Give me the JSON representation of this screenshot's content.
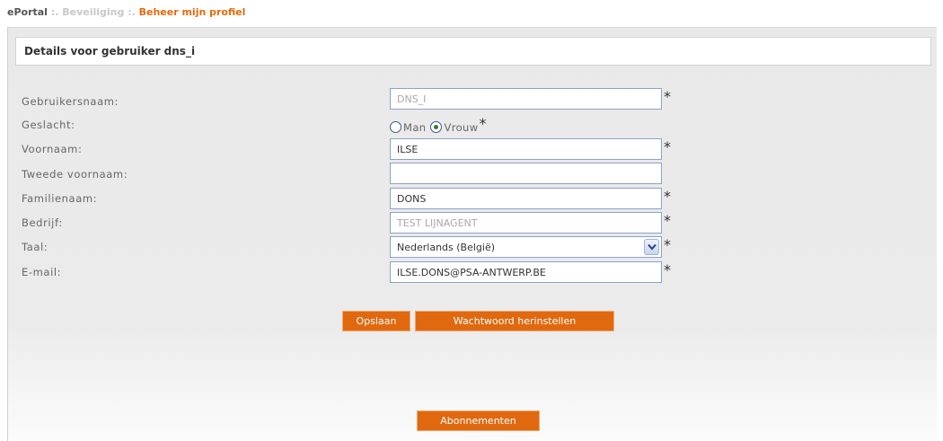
{
  "breadcrumb": {
    "root": "ePortal",
    "separator": " :. ",
    "middle": "Beveiliging",
    "current": "Beheer mijn profiel"
  },
  "panel": {
    "title": "Details voor gebruiker dns_i"
  },
  "form": {
    "required_mark": "*",
    "username": {
      "label": "Gebruikersnaam:",
      "value": "DNS_I",
      "editable": false
    },
    "gender": {
      "label": "Geslacht:",
      "options": [
        "Man",
        "Vrouw"
      ],
      "selected": "Vrouw"
    },
    "first_name": {
      "label": "Voornaam:",
      "value": "ILSE"
    },
    "second_first_name": {
      "label": "Tweede voornaam:",
      "value": ""
    },
    "last_name": {
      "label": "Familienaam:",
      "value": "DONS"
    },
    "company": {
      "label": "Bedrijf:",
      "value": "TEST LIJNAGENT",
      "editable": false
    },
    "language": {
      "label": "Taal:",
      "value": "Nederlands (België)"
    },
    "email": {
      "label": "E-mail:",
      "value": "ILSE.DONS@PSA-ANTWERP.BE"
    }
  },
  "buttons": {
    "save": "Opslaan",
    "reset_password": "Wachtwoord herinstellen",
    "subscriptions": "Abonnementen"
  },
  "colors": {
    "accent": "#e0690f",
    "breadcrumb_current": "#e36a0c",
    "input_border": "#8aa2c8",
    "panel_background": "#e9e9e9"
  },
  "icons": {
    "select_arrow": "chevron-down-icon",
    "required": "asterisk-icon"
  }
}
